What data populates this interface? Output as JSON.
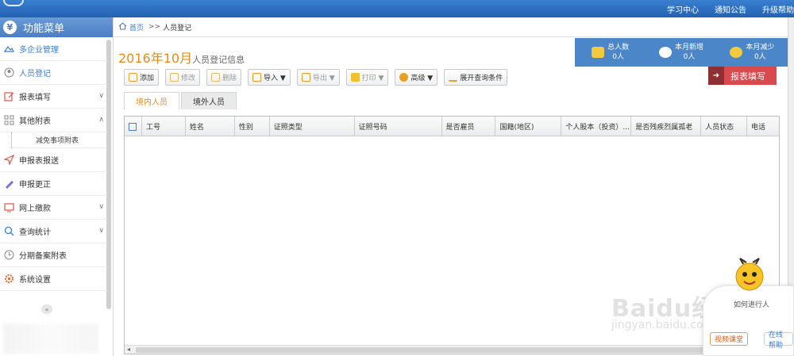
{
  "topbar": {
    "links": [
      "学习中心",
      "通知公告",
      "升级帮助"
    ]
  },
  "sidebar": {
    "header": "功能菜单",
    "header_icon": "¥",
    "items": [
      {
        "label": "多企业管理",
        "icon": "enterprise-icon",
        "has_arrow": false
      },
      {
        "label": "人员登记",
        "icon": "person-icon",
        "has_arrow": false
      },
      {
        "label": "报表填写",
        "icon": "edit-icon",
        "has_arrow": true
      },
      {
        "label": "其他附表",
        "icon": "grid-icon",
        "has_arrow": true
      }
    ],
    "sub_item": "减免事项附表",
    "items2": [
      {
        "label": "申报表报送",
        "icon": "send-icon",
        "has_arrow": false
      },
      {
        "label": "申报更正",
        "icon": "pen-icon",
        "has_arrow": false
      },
      {
        "label": "网上缴款",
        "icon": "monitor-icon",
        "has_arrow": true
      },
      {
        "label": "查询统计",
        "icon": "search-icon",
        "has_arrow": true
      },
      {
        "label": "分期备案附表",
        "icon": "clock-icon",
        "has_arrow": false
      },
      {
        "label": "系统设置",
        "icon": "gear-icon",
        "has_arrow": false
      }
    ],
    "collapse": "«"
  },
  "breadcrumb": {
    "home": "首页",
    "sep": ">>",
    "current": "人员登记"
  },
  "page_title": {
    "period": "2016年10月",
    "suffix": "人员登记信息"
  },
  "stats": [
    {
      "label": "总人数",
      "value": "0人"
    },
    {
      "label": "本月新增",
      "value": "0人"
    },
    {
      "label": "本月减少",
      "value": "0人"
    }
  ],
  "report_button": "报表填写",
  "toolbar": {
    "add": "添加",
    "modify": "修改",
    "delete": "删除",
    "import": "导入 ▼",
    "export": "导出 ▼",
    "print": "打印 ▼",
    "advanced": "高级 ▼",
    "expand_query": "展开查询条件"
  },
  "tabs": [
    "境内人员",
    "境外人员"
  ],
  "grid": {
    "columns": [
      "工号",
      "姓名",
      "性别",
      "证照类型",
      "证照号码",
      "是否雇员",
      "国籍(地区)",
      "个人股本（投资）...",
      "是否残疾烈属孤老",
      "人员状态",
      "电话"
    ]
  },
  "help": {
    "question": "如何进行人",
    "video": "视频课堂",
    "online": "在线帮助"
  },
  "watermark": {
    "main": "Baidu经验",
    "sub": "jingyan.baidu.com"
  }
}
